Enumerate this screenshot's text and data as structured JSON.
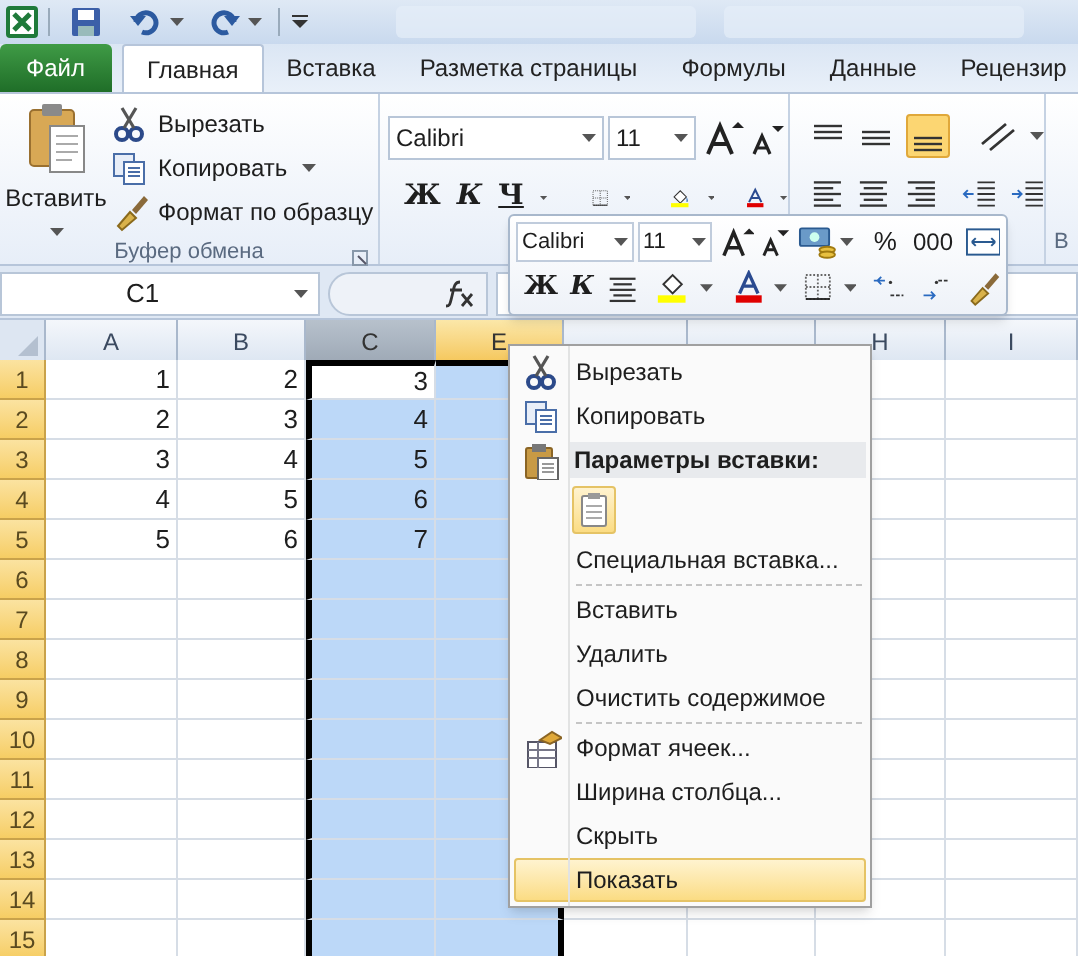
{
  "ribbon_tabs": [
    {
      "label": "Файл",
      "kind": "backstage",
      "selected": false
    },
    {
      "label": "Главная",
      "kind": "tab",
      "selected": true
    },
    {
      "label": "Вставка",
      "kind": "tab",
      "selected": false
    },
    {
      "label": "Разметка страницы",
      "kind": "tab",
      "selected": false
    },
    {
      "label": "Формулы",
      "kind": "tab",
      "selected": false
    },
    {
      "label": "Данные",
      "kind": "tab",
      "selected": false
    },
    {
      "label": "Рецензир",
      "kind": "tab",
      "selected": false
    }
  ],
  "clipboard_group": {
    "paste": "Вставить",
    "commands": [
      {
        "label": "Вырезать",
        "dropdown": false
      },
      {
        "label": "Копировать",
        "dropdown": true
      },
      {
        "label": "Формат по образцу",
        "dropdown": false
      }
    ],
    "title": "Буфер обмена"
  },
  "font_group": {
    "font": "Calibri",
    "size": "11",
    "bold": "Ж",
    "italic": "К",
    "underline": "Ч"
  },
  "next_group_title": "В",
  "formula_bar": {
    "name_box": "C1"
  },
  "sheet": {
    "columns": [
      {
        "label": "A",
        "selected": false,
        "active": false
      },
      {
        "label": "B",
        "selected": false,
        "active": false
      },
      {
        "label": "C",
        "selected": true,
        "active": true
      },
      {
        "label": "E",
        "selected": true,
        "active": false
      },
      {
        "selected": false,
        "active": false
      },
      {
        "selected": false,
        "active": false
      },
      {
        "label": "H",
        "selected": false,
        "active": false
      },
      {
        "label": "I",
        "selected": false,
        "active": false
      }
    ],
    "rows": [
      {
        "header": "1",
        "selected": true,
        "active": true,
        "cells": [
          "1",
          "2",
          "3"
        ]
      },
      {
        "header": "2",
        "selected": true,
        "active": false,
        "cells": [
          "2",
          "3",
          "4"
        ]
      },
      {
        "header": "3",
        "selected": true,
        "active": false,
        "cells": [
          "3",
          "4",
          "5"
        ]
      },
      {
        "header": "4",
        "selected": true,
        "active": false,
        "cells": [
          "4",
          "5",
          "6"
        ]
      },
      {
        "header": "5",
        "selected": true,
        "active": false,
        "cells": [
          "5",
          "6",
          "7"
        ]
      },
      {
        "header": "6",
        "selected": true,
        "active": false,
        "cells": []
      },
      {
        "header": "7",
        "selected": true,
        "active": false,
        "cells": []
      },
      {
        "header": "8",
        "selected": true,
        "active": false,
        "cells": []
      },
      {
        "header": "9",
        "selected": true,
        "active": false,
        "cells": []
      },
      {
        "header": "10",
        "selected": true,
        "active": false,
        "cells": []
      },
      {
        "header": "11",
        "selected": true,
        "active": false,
        "cells": []
      },
      {
        "header": "12",
        "selected": true,
        "active": false,
        "cells": []
      },
      {
        "header": "13",
        "selected": true,
        "active": false,
        "cells": []
      },
      {
        "header": "14",
        "selected": true,
        "active": false,
        "cells": []
      },
      {
        "header": "15",
        "selected": true,
        "active": false,
        "cells": []
      }
    ]
  },
  "mini_toolbar": {
    "font": "Calibri",
    "size": "11",
    "percent": "%",
    "thousands": "000",
    "bold": "Ж",
    "italic": "К"
  },
  "context_menu": [
    {
      "kind": "command",
      "label": "Вырезать",
      "selected": false
    },
    {
      "kind": "command",
      "label": "Копировать",
      "selected": false
    },
    {
      "kind": "header",
      "label": "Параметры вставки:"
    },
    {
      "kind": "paste_option"
    },
    {
      "kind": "command",
      "label": "Специальная вставка...",
      "selected": false
    },
    {
      "kind": "separator"
    },
    {
      "kind": "command",
      "label": "Вставить",
      "selected": false
    },
    {
      "kind": "command",
      "label": "Удалить",
      "selected": false
    },
    {
      "kind": "command",
      "label": "Очистить содержимое",
      "selected": false
    },
    {
      "kind": "separator"
    },
    {
      "kind": "command",
      "label": "Формат ячеек...",
      "selected": false
    },
    {
      "kind": "command",
      "label": "Ширина столбца...",
      "selected": false
    },
    {
      "kind": "command",
      "label": "Скрыть",
      "selected": false
    },
    {
      "kind": "command",
      "label": "Показать",
      "selected": true
    }
  ]
}
